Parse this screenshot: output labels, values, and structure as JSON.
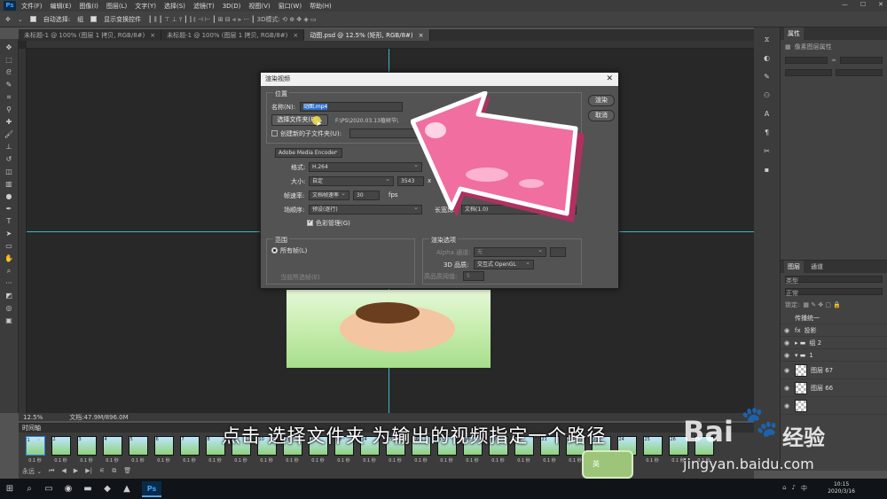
{
  "menu": {
    "app": "Ps",
    "items": [
      "文件(F)",
      "编辑(E)",
      "图像(I)",
      "图层(L)",
      "文字(Y)",
      "选择(S)",
      "滤镜(T)",
      "3D(D)",
      "视图(V)",
      "窗口(W)",
      "帮助(H)"
    ]
  },
  "options": {
    "auto_select": "自动选择:",
    "layer_select": "组",
    "transform": "显示变换控件"
  },
  "tabs": [
    {
      "label": "未标题-1 @ 100% (图层 1 拷贝, RGB/8#)",
      "active": false
    },
    {
      "label": "未标题-1 @ 100% (图层 1 拷贝, RGB/8#)",
      "active": false
    },
    {
      "label": "动图.psd @ 12.5% (矩形, RGB/8#)",
      "active": true
    }
  ],
  "status": {
    "zoom": "12.5%",
    "doc": "文档:47.9M/896.0M"
  },
  "dialog": {
    "title": "渲染视频",
    "location_group": "位置",
    "name_label": "名称(N):",
    "name_value": "动图.mp4",
    "choose_folder": "选择文件夹(F)...",
    "path": "F:\\PS\\2020.03.13植树节\\",
    "create_subfolder": "创建新的子文件夹(U):",
    "encoder": "Adobe Media Encoder",
    "format_label": "格式:",
    "format_value": "H.264",
    "size_label": "大小:",
    "size_value": "自定",
    "width": "3543",
    "x_sep": "x",
    "fps_label": "帧速率:",
    "fps_select": "文档帧速率",
    "fps_value": "30",
    "fps_unit": "fps",
    "field_label": "场顺序:",
    "field_value": "预设(逐行)",
    "aspect_label": "长宽比:",
    "aspect_value": "文档(1.0)",
    "color_mgmt": "色彩管理(G)",
    "range_group": "范围",
    "all_frames": "所有帧(L)",
    "selected_frames": "当前所选帧(E)",
    "render_group": "渲染选项",
    "alpha_label": "Alpha 通道:",
    "alpha_value": "无",
    "quality_label": "3D 品质:",
    "quality_value": "交互式 OpenGL",
    "hq_label": "高品质阈值:",
    "hq_value": "5",
    "render_btn": "渲染",
    "cancel_btn": "取消"
  },
  "properties": {
    "tab": "属性",
    "tab2": "",
    "title": "像素图层属性"
  },
  "layers": {
    "tabs": [
      "图层",
      "通道"
    ],
    "search": "类型",
    "mode": "正常",
    "lock": "锁定:",
    "items": [
      {
        "name": "传播统一",
        "type": "unify"
      },
      {
        "name": "投影",
        "type": "fx"
      },
      {
        "name": "组 2",
        "type": "group"
      },
      {
        "name": "1",
        "type": "group"
      },
      {
        "name": "图层 67",
        "type": "layer"
      },
      {
        "name": "图层 66",
        "type": "layer"
      },
      {
        "name": "",
        "type": "layer"
      }
    ]
  },
  "timeline": {
    "title": "时间轴",
    "frame_count": 27,
    "duration": "0.1 秒"
  },
  "subtitle": "点击 选择文件夹 为输出的视频指定一个路径",
  "watermark": {
    "brand": "Bai",
    "brand2": "经验",
    "url": "jingyan.baidu.com"
  },
  "badge": "英",
  "taskbar": {
    "time": "10:15",
    "date": "2020/3/16"
  }
}
